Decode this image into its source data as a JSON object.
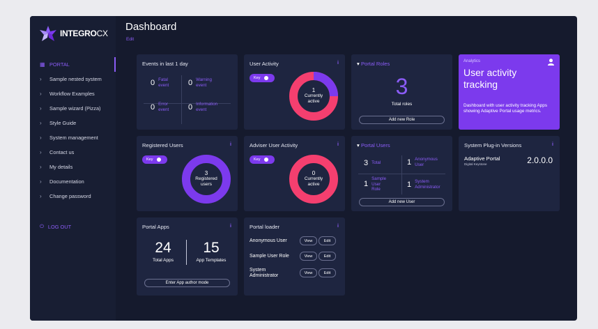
{
  "brand": {
    "name_bold": "INTEGRO",
    "name_thin": "CX"
  },
  "header": {
    "title": "Dashboard",
    "edit_label": "Edit"
  },
  "sidebar": {
    "items": [
      {
        "label": "PORTAL",
        "active": true
      },
      {
        "label": "Sample nested system"
      },
      {
        "label": "Workflow Examples"
      },
      {
        "label": "Sample wizard (Pizza)"
      },
      {
        "label": "Style Guide"
      },
      {
        "label": "System management"
      },
      {
        "label": "Contact us"
      },
      {
        "label": "My details"
      },
      {
        "label": "Documentation"
      },
      {
        "label": "Change password"
      }
    ],
    "logout_label": "LOG OUT"
  },
  "events": {
    "title": "Events in last 1 day",
    "items": [
      {
        "count": "0",
        "label_1": "Fatal",
        "label_2": "event"
      },
      {
        "count": "0",
        "label_1": "Warning",
        "label_2": "event"
      },
      {
        "count": "0",
        "label_1": "Error",
        "label_2": "event"
      },
      {
        "count": "0",
        "label_1": "Information",
        "label_2": "event"
      }
    ]
  },
  "user_activity": {
    "title": "User Activity",
    "key_label": "Key",
    "count": "1",
    "label_1": "Currently",
    "label_2": "active",
    "active_fraction": 0.2
  },
  "portal_roles": {
    "title": "Portal Roles",
    "count": "3",
    "caption": "Total roles",
    "button": "Add new Role"
  },
  "analytics": {
    "tag": "Analytics",
    "heading_1": "User activity",
    "heading_2": "tracking",
    "body": "Dashboard with user activity tracking Apps showing Adaptive Portal usage metrics."
  },
  "registered_users": {
    "title": "Registered Users",
    "key_label": "Key",
    "count": "3",
    "label_1": "Registered",
    "label_2": "users"
  },
  "adviser_activity": {
    "title": "Adviser User Activity",
    "key_label": "Key",
    "count": "0",
    "label_1": "Currently",
    "label_2": "active"
  },
  "portal_users": {
    "title": "Portal Users",
    "cells": [
      {
        "count": "3",
        "label_1": "Total",
        "label_2": "",
        "label_3": ""
      },
      {
        "count": "1",
        "label_1": "Anonymous",
        "label_2": "User",
        "label_3": ""
      },
      {
        "count": "1",
        "label_1": "Sample",
        "label_2": "User",
        "label_3": "Role"
      },
      {
        "count": "1",
        "label_1": "System",
        "label_2": "Administrator",
        "label_3": ""
      }
    ],
    "button": "Add new User"
  },
  "plugins": {
    "title": "System Plug-in Versions",
    "name": "Adaptive Portal",
    "sub": "Digital Keystone",
    "version": "2.0.0.0"
  },
  "portal_apps": {
    "title": "Portal Apps",
    "total_apps": "24",
    "total_apps_label": "Total Apps",
    "templates": "15",
    "templates_label": "App Templates",
    "button": "Enter App author mode"
  },
  "portal_loader": {
    "title": "Portal loader",
    "rows": [
      {
        "label_1": "Anonymous User",
        "label_2": "",
        "view": "View",
        "edit": "Edit"
      },
      {
        "label_1": "Sample User Role",
        "label_2": "",
        "view": "View",
        "edit": "Edit"
      },
      {
        "label_1": "System",
        "label_2": "Administrator",
        "view": "View",
        "edit": "Edit"
      }
    ]
  },
  "colors": {
    "background": "#151a2d",
    "card": "#1e2540",
    "accent": "#8b5cf6",
    "donut_pink": "#f43f6f",
    "donut_purple": "#7c3aed"
  }
}
